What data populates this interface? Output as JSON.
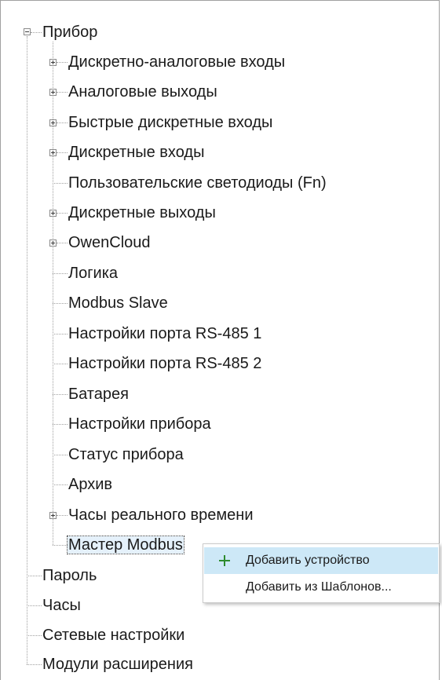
{
  "tree": {
    "root": {
      "label": "Прибор",
      "expanded": true
    },
    "children": [
      {
        "label": "Дискретно-аналоговые входы",
        "expandable": true
      },
      {
        "label": "Аналоговые выходы",
        "expandable": true
      },
      {
        "label": "Быстрые дискретные входы",
        "expandable": true
      },
      {
        "label": "Дискретные входы",
        "expandable": true
      },
      {
        "label": "Пользовательские светодиоды (Fn)",
        "expandable": false
      },
      {
        "label": "Дискретные выходы",
        "expandable": true
      },
      {
        "label": "OwenCloud",
        "expandable": true
      },
      {
        "label": "Логика",
        "expandable": false
      },
      {
        "label": "Modbus Slave",
        "expandable": false
      },
      {
        "label": "Настройки порта RS-485 1",
        "expandable": false
      },
      {
        "label": "Настройки порта RS-485 2",
        "expandable": false
      },
      {
        "label": "Батарея",
        "expandable": false
      },
      {
        "label": "Настройки прибора",
        "expandable": false
      },
      {
        "label": "Статус прибора",
        "expandable": false
      },
      {
        "label": "Архив",
        "expandable": false
      },
      {
        "label": "Часы реального времени",
        "expandable": true
      },
      {
        "label": "Мастер Modbus",
        "expandable": false,
        "selected": true
      }
    ],
    "top_level": [
      {
        "label": "Пароль"
      },
      {
        "label": "Часы"
      },
      {
        "label": "Сетевые настройки"
      },
      {
        "label": "Модули расширения"
      }
    ]
  },
  "context_menu": {
    "items": [
      {
        "label": "Добавить устройство",
        "icon": "plus-icon",
        "highlighted": true
      },
      {
        "label": "Добавить из Шаблонов...",
        "icon": "",
        "highlighted": false
      }
    ]
  },
  "colors": {
    "selection_bg": "#e5f1fb",
    "menu_hover_bg": "#cde8f7",
    "plus_icon": "#2e8b2e",
    "tree_lines": "#a0a0a0"
  }
}
